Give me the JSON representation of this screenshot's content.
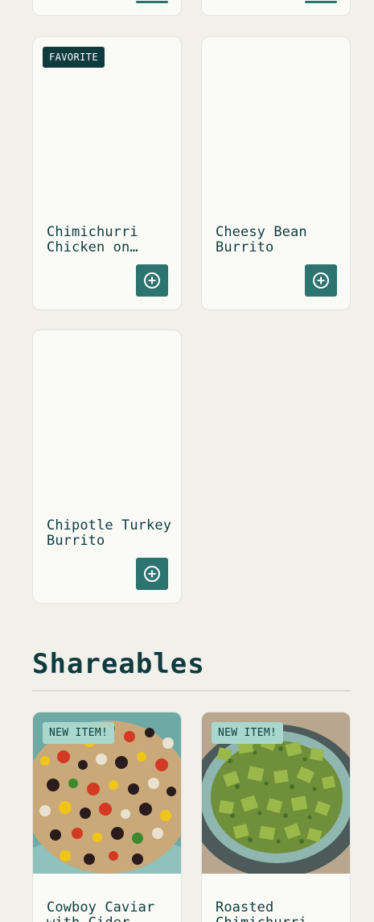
{
  "colors": {
    "background": "#f1f0eb",
    "card": "#fafaf7",
    "accent": "#2d7370",
    "heading": "#0f3b3e",
    "badge_new": "#a9d6cd"
  },
  "top_cards": [
    {
      "add_icon": "plus-circle-icon"
    },
    {
      "add_icon": "plus-circle-icon"
    }
  ],
  "items": [
    {
      "title": "Chimichurri Chicken on…",
      "badge": "FAVORITE",
      "add_icon": "plus-circle-icon"
    },
    {
      "title": "Cheesy Bean Burrito",
      "badge": "",
      "add_icon": "plus-circle-icon"
    },
    {
      "title": "Chipotle Turkey Burrito",
      "badge": "",
      "add_icon": "plus-circle-icon"
    }
  ],
  "section": {
    "title": "Shareables"
  },
  "shareables": [
    {
      "title": "Cowboy Caviar with Cider",
      "badge": "NEW ITEM!",
      "image": "cowboy-caviar-photo"
    },
    {
      "title": "Roasted Chimichurri",
      "badge": "NEW ITEM!",
      "image": "chimichurri-tofu-photo"
    }
  ]
}
